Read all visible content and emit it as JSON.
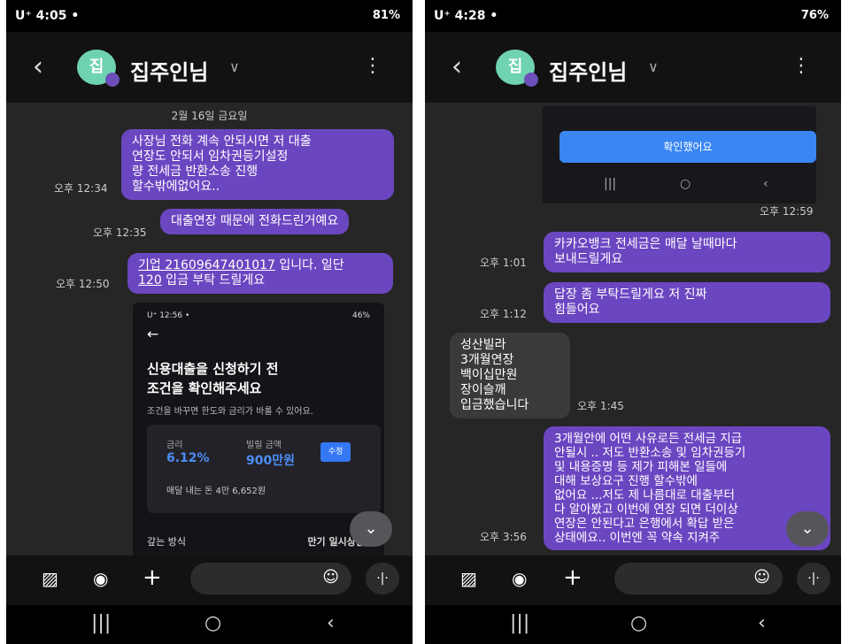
{
  "left": {
    "status": {
      "time": "U⁺ 4:05 •",
      "right": "81%"
    },
    "header": {
      "avatar": "집",
      "name": "집주인님",
      "chevron": "∨",
      "back": "‹",
      "menu": "⋮"
    },
    "date": "2월 16일 금요일",
    "messages": [
      {
        "text": "사장님 전화 계속 안되시면 저 대출\n연장도 안되서 임차권등기설정\n량 전세금 반환소송 진행\n할수밖에없어요..",
        "time": "오후 12:34"
      },
      {
        "text": "대출연장 때문에 전화드린거예요",
        "time": "오후 12:35"
      },
      {
        "line1_link": "기업 21609647401017",
        "line1_rest": " 입니다. 일단",
        "line2_link": "120",
        "line2_rest": " 입금 부탁 드릴게요",
        "time": "오후 12:50"
      }
    ],
    "shot": {
      "status_left": "U⁺ 12:56 •",
      "status_right": "46%",
      "back": "←",
      "title1": "신용대출을 신청하기 전",
      "title2": "조건을 확인해주세요",
      "subtitle": "조건을 바꾸면 한도와 금리가 바롤 수 있어요.",
      "rate_label": "금리",
      "rate_value": "6.12%",
      "amount_label": "빌릴 금액",
      "amount_value": "900만원",
      "edit": "수정",
      "monthly": "매달 내는 돈  4만 6,652원",
      "repay_label": "갚는 방식",
      "repay_value": "만기 일시상환"
    },
    "scroll_down": "⌄"
  },
  "right": {
    "status": {
      "time": "U⁺ 4:28 •",
      "right": "76%"
    },
    "header": {
      "avatar": "집",
      "name": "집주인님",
      "chevron": "∨",
      "back": "‹",
      "menu": "⋮"
    },
    "confirm_button": "확인했어요",
    "shot_time": "오후 12:59",
    "messages": [
      {
        "text": "카카오뱅크 전세금은 매달 날때마다\n보내드릴게요",
        "time": "오후 1:01"
      },
      {
        "text": "답장 좀 부탁드릴게요 저 진짜\n힘들어요",
        "time": "오후 1:12"
      },
      {
        "text": "성산빌라\n3개월연장\n백이십만원\n장이슬깨\n입금했습니다",
        "time": "오후 1:45"
      },
      {
        "text": "3개월안에 어떤 사유로든 전세금 지급\n안될시 .. 저도 반환소송 및 임차권등기\n및 내용증명 등 제가 피해본 일들에\n대해 보상요구 진행 할수밖에\n없어요 ...저도 제 나름대로 대출부터\n다 알아봤고 이번에 연장 되면 더이상\n연장은 안된다고 은행에서 확답 받은\n상태에요.. 이번엔 꼭 약속 지켜주",
        "time": "오후 3:56"
      }
    ],
    "scroll_down": "⌄"
  },
  "input_bar": {
    "gallery": "▨",
    "camera": "◉",
    "plus": "+",
    "emoji": "☺",
    "voice": "·|·"
  },
  "nav": {
    "recents": "|||",
    "home": "○",
    "back": "‹"
  }
}
